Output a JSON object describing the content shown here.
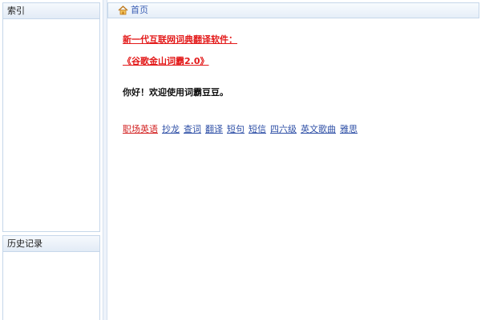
{
  "sidebar": {
    "index_title": "索引",
    "history_title": "历史记录"
  },
  "address_bar": {
    "home_label": "首页",
    "home_icon": "home-icon"
  },
  "content": {
    "promo_line_1": "新一代互联网词典翻译软件：",
    "promo_line_2": "《谷歌金山词霸2.0》",
    "greeting": "你好！欢迎使用词霸豆豆。",
    "tags": [
      {
        "label": "职场英语",
        "color": "#d21f1f"
      },
      {
        "label": "抄龙",
        "color": "#2e4fa6"
      },
      {
        "label": "查词",
        "color": "#2e4fa6"
      },
      {
        "label": "翻译",
        "color": "#2e4fa6"
      },
      {
        "label": "短句",
        "color": "#2e4fa6"
      },
      {
        "label": "短信",
        "color": "#2e4fa6"
      },
      {
        "label": "四六级",
        "color": "#2e4fa6"
      },
      {
        "label": "英文歌曲",
        "color": "#2e4fa6"
      },
      {
        "label": "雅思",
        "color": "#2e4fa6"
      }
    ]
  },
  "colors": {
    "accent_red": "#e31a1a",
    "link_blue": "#2e4fa6",
    "panel_border": "#c6d7ea"
  }
}
